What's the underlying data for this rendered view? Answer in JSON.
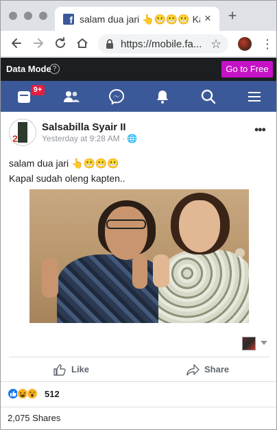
{
  "browser": {
    "tab_title": "salam dua jari 👆😬😬😬 Kapal",
    "tab_close": "×",
    "new_tab": "+",
    "url": "https://mobile.fa..."
  },
  "data_mode": {
    "label": "Data Mode",
    "help": "?",
    "go_free": "Go to Free",
    "go_free_color": "#c512c6"
  },
  "nav": {
    "background": "#3b5998",
    "home_badge": "9+",
    "items": [
      "home-icon",
      "friends-icon",
      "messenger-icon",
      "notifications-icon",
      "search-icon",
      "menu-icon"
    ]
  },
  "post": {
    "author": "Salsabilla Syair II",
    "time": "Yesterday at 9:28 AM · 🌐",
    "more": "•••",
    "line1": "salam dua jari 👆😬😬😬",
    "line2": "Kapal sudah oleng kapten..",
    "like_label": "Like",
    "share_label": "Share",
    "reaction_count": "512",
    "shares_text": "2,075 Shares"
  }
}
